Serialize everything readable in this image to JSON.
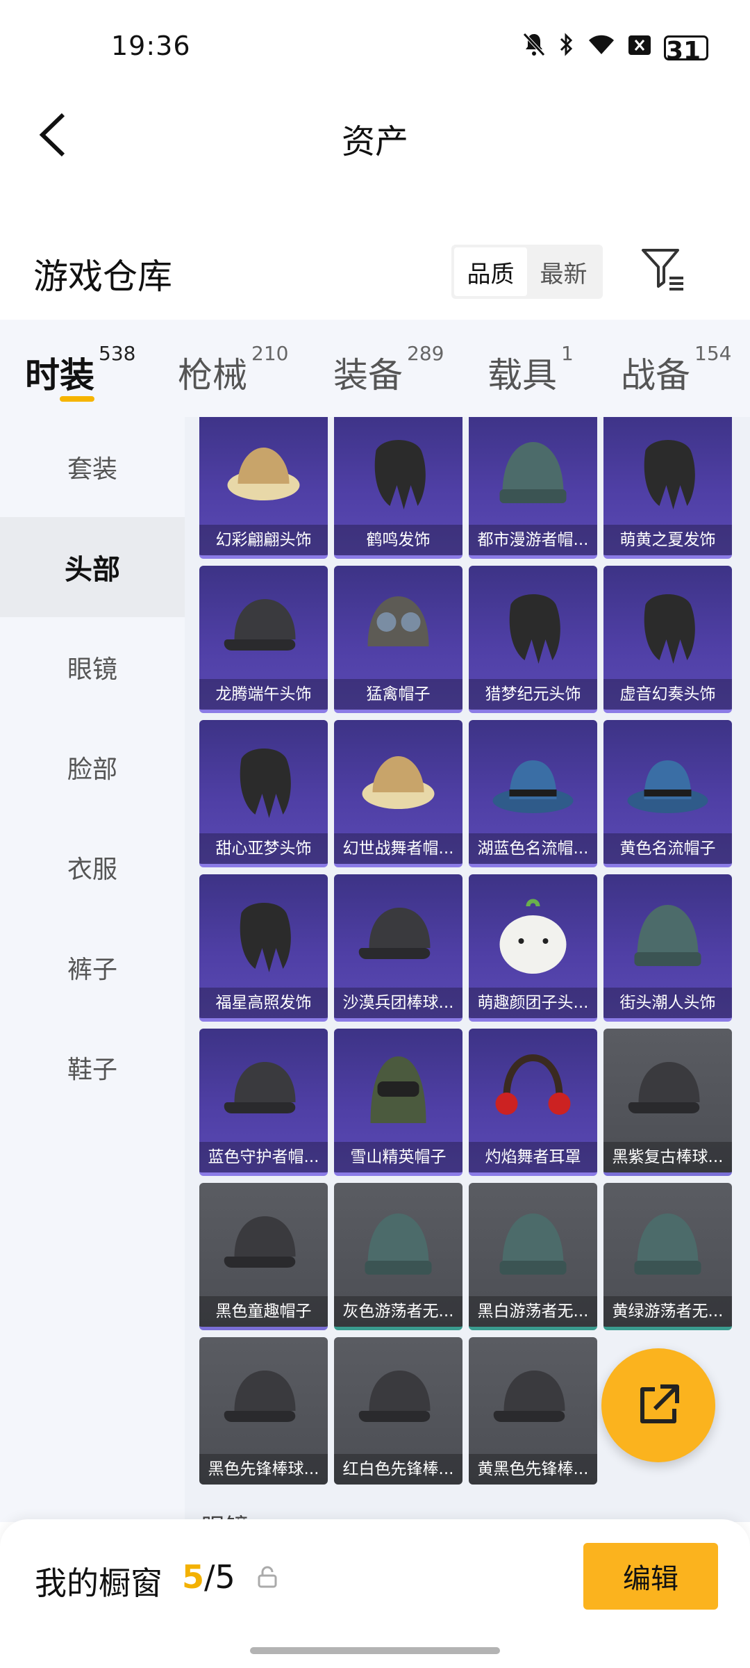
{
  "status_bar": {
    "time": "19:36",
    "battery": "31"
  },
  "header": {
    "title": "资产"
  },
  "warehouse": {
    "title": "游戏仓库",
    "sort_options": [
      "品质",
      "最新"
    ],
    "active_sort": "品质"
  },
  "tabs": [
    {
      "label": "时装",
      "count": "538",
      "active": true
    },
    {
      "label": "枪械",
      "count": "210"
    },
    {
      "label": "装备",
      "count": "289"
    },
    {
      "label": "载具",
      "count": "1"
    },
    {
      "label": "战备",
      "count": "154"
    }
  ],
  "sidebar": [
    {
      "label": "套装"
    },
    {
      "label": "头部",
      "active": true
    },
    {
      "label": "眼镜"
    },
    {
      "label": "脸部"
    },
    {
      "label": "衣服"
    },
    {
      "label": "裤子"
    },
    {
      "label": "鞋子"
    }
  ],
  "items": [
    {
      "name": "幻彩翩翩头饰",
      "rarity": "purple",
      "icon": "hat-icon"
    },
    {
      "name": "鹤鸣发饰",
      "rarity": "purple",
      "icon": "hair-icon"
    },
    {
      "name": "都市漫游者帽...",
      "rarity": "purple",
      "icon": "beanie-icon"
    },
    {
      "name": "萌黄之夏发饰",
      "rarity": "purple",
      "icon": "hair-icon"
    },
    {
      "name": "龙腾端午头饰",
      "rarity": "purple",
      "icon": "cap-icon"
    },
    {
      "name": "猛禽帽子",
      "rarity": "purple",
      "icon": "helmet-icon"
    },
    {
      "name": "猎梦纪元头饰",
      "rarity": "purple",
      "icon": "hair-icon"
    },
    {
      "name": "虚音幻奏头饰",
      "rarity": "purple",
      "icon": "hair-icon"
    },
    {
      "name": "甜心亚梦头饰",
      "rarity": "purple",
      "icon": "hair-icon"
    },
    {
      "name": "幻世战舞者帽...",
      "rarity": "purple",
      "icon": "hat-icon"
    },
    {
      "name": "湖蓝色名流帽...",
      "rarity": "purple",
      "icon": "fedora-icon"
    },
    {
      "name": "黄色名流帽子",
      "rarity": "purple",
      "icon": "fedora-icon"
    },
    {
      "name": "福星高照发饰",
      "rarity": "purple",
      "icon": "hair-icon"
    },
    {
      "name": "沙漠兵团棒球...",
      "rarity": "purple",
      "icon": "cap-icon"
    },
    {
      "name": "萌趣颜团子头...",
      "rarity": "purple",
      "icon": "dumpling-icon"
    },
    {
      "name": "街头潮人头饰",
      "rarity": "purple",
      "icon": "beanie-icon"
    },
    {
      "name": "蓝色守护者帽...",
      "rarity": "purple",
      "icon": "cap-icon"
    },
    {
      "name": "雪山精英帽子",
      "rarity": "purple",
      "icon": "balaclava-icon"
    },
    {
      "name": "灼焰舞者耳罩",
      "rarity": "purple",
      "icon": "headphones-icon"
    },
    {
      "name": "黑紫复古棒球...",
      "rarity": "gray-purple",
      "icon": "cap-icon"
    },
    {
      "name": "黑色童趣帽子",
      "rarity": "gray-purple",
      "icon": "cap-icon"
    },
    {
      "name": "灰色游荡者无...",
      "rarity": "gray-teal",
      "icon": "beanie-icon"
    },
    {
      "name": "黑白游荡者无...",
      "rarity": "gray-teal",
      "icon": "beanie-icon"
    },
    {
      "name": "黄绿游荡者无...",
      "rarity": "gray-teal",
      "icon": "beanie-icon"
    },
    {
      "name": "黑色先锋棒球...",
      "rarity": "gray",
      "icon": "cap-icon"
    },
    {
      "name": "红白色先锋棒...",
      "rarity": "gray",
      "icon": "cap-icon"
    },
    {
      "name": "黄黑色先锋棒...",
      "rarity": "gray",
      "icon": "cap-icon"
    }
  ],
  "next_section_label": "眼镜",
  "showcase": {
    "title": "我的橱窗",
    "current": "5",
    "sep": "/",
    "total": "5",
    "edit_label": "编辑"
  },
  "colors": {
    "accent": "#fbb31e",
    "purple_card": "#4f3fa5",
    "gray_card": "#54565c"
  }
}
